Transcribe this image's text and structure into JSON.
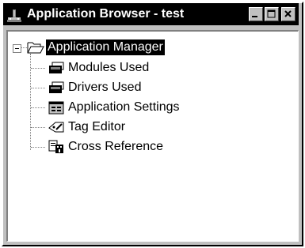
{
  "window": {
    "title": "Application Browser - test",
    "icon": "application-browser-icon"
  },
  "caption_buttons": {
    "minimize": "minimize-icon",
    "maximize": "maximize-icon",
    "close": "close-icon"
  },
  "tree": {
    "root": {
      "label": "Application Manager",
      "icon": "open-folder-icon",
      "expanded": true,
      "selected": true
    },
    "children": [
      {
        "label": "Modules Used",
        "icon": "modules-icon"
      },
      {
        "label": "Drivers Used",
        "icon": "drivers-icon"
      },
      {
        "label": "Application Settings",
        "icon": "settings-icon"
      },
      {
        "label": "Tag Editor",
        "icon": "tag-editor-icon"
      },
      {
        "label": "Cross Reference",
        "icon": "cross-reference-icon"
      }
    ]
  }
}
